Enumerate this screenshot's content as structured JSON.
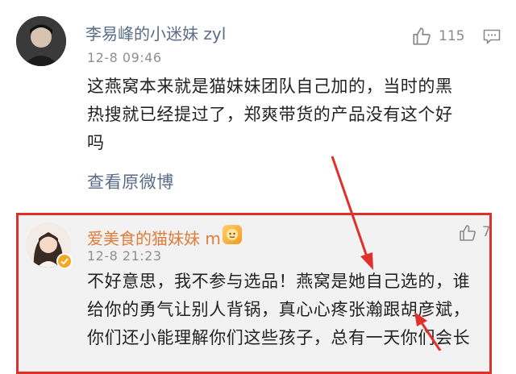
{
  "colors": {
    "link": "#5a6c87",
    "accent": "#e0302a",
    "reply_bg": "#f2f2f2",
    "text": "#222222",
    "meta": "#8f8f8f"
  },
  "comment": {
    "author": "李易峰的小迷妹 zyl",
    "time": "12-8 09:46",
    "lines": [
      "这燕窝本来就是猫妹妹团队自己加的，当时的黑",
      "热搜就已经提过了，郑爽带货的产品没有这个好",
      "吗"
    ],
    "view_original": "查看原微博",
    "likes": "115",
    "like_icon": "thumbs-up-icon",
    "reply_icon": "comment-icon"
  },
  "reply": {
    "author": "爱美食的猫妹妹 m",
    "time": "12-8 21:23",
    "lines": [
      "不好意思，我不参与选品！燕窝是她自己选的，谁",
      "给你的勇气让别人背锅，真心心疼张瀚跟胡彦斌，",
      "你们还小能理解你们这些孩子，总有一天你们会长"
    ],
    "likes": "7",
    "verified_icon": "verified-badge-icon",
    "member_icon": "vip-badge-icon"
  }
}
